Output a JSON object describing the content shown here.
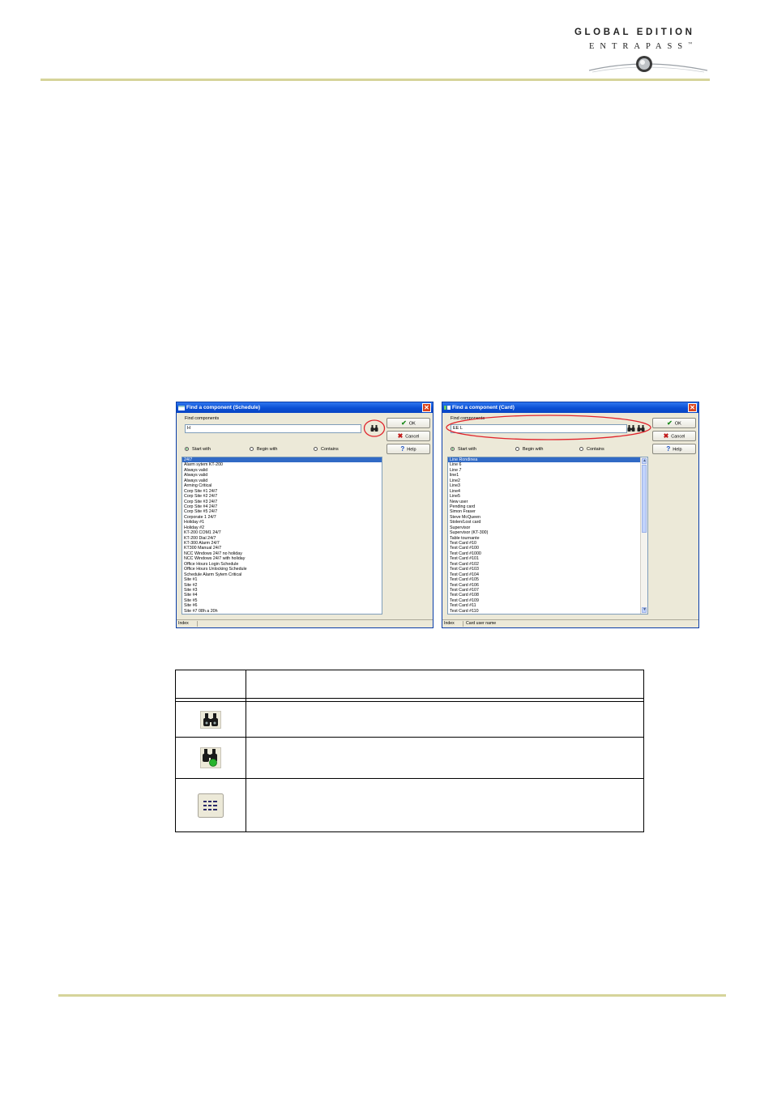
{
  "header": {
    "logo_line1": "GLOBAL EDITION",
    "logo_line2": "ENTRAPASS",
    "logo_mark": "™"
  },
  "dialog_schedule": {
    "title": "Find a component (Schedule)",
    "find_label": "Find components",
    "search_value": "H",
    "ok_label": "OK",
    "cancel_label": "Cancel",
    "help_label": "Help",
    "radio_options": [
      "Start with",
      "Begin with",
      "Contains"
    ],
    "selected_radio": 0,
    "items": [
      "24/7",
      "Alarm sytem KT-200",
      "Always valid",
      "Always valid",
      "Always valid",
      "Arming Critical",
      "Corp Site #1 24/7",
      "Corp Site #2 24/7",
      "Corp Site #3 24/7",
      "Corp Site #4 24/7",
      "Corp Site #5 24/7",
      "Corporate 1 24/7",
      "Holiday #1",
      "Holiday #2",
      "KT-200 COM1 24/7",
      "KT-200 Dial 24/7",
      "KT-300 Alarm 24/7",
      "KT300 Manual 24/7",
      "NCC Windows 24/7 no holiday",
      "NCC Windows 24/7 with holiday",
      "Office Hours Login Schedule",
      "Office Hours Unlocking Schedule",
      "Schedule Alarm Sytem Critical",
      "Site #1",
      "Site #2",
      "Site #3",
      "Site #4",
      "Site #5",
      "Site #6",
      "Site #7 08h a 20h"
    ],
    "status": [
      "Index"
    ]
  },
  "dialog_card": {
    "title": "Find a component (Card)",
    "find_label": "Find components",
    "search_value": "EE L",
    "ok_label": "OK",
    "cancel_label": "Cancel",
    "help_label": "Help",
    "radio_options": [
      "Start with",
      "Begin with",
      "Contains"
    ],
    "selected_radio": 0,
    "items": [
      "Line Rondinea",
      "Line 6",
      "Line 7",
      "line1",
      "Line2",
      "Line3",
      "Line4",
      "Line5",
      "New user",
      "Pending card",
      "Simon Fraser",
      "Steve McQueen",
      "Stolen/Lost card",
      "Supervisor",
      "Supervisor (KT-300)",
      "Table tournante",
      "Test Card #10",
      "Test Card #100",
      "Test Card #1000",
      "Test Card #101",
      "Test Card #102",
      "Test Card #103",
      "Test Card #104",
      "Test Card #105",
      "Test Card #106",
      "Test Card #107",
      "Test Card #108",
      "Test Card #109",
      "Test Card #11",
      "Test Card #110"
    ],
    "status": [
      "Index",
      "Card user name"
    ]
  },
  "table": {
    "icons": [
      "binoculars-icon",
      "binoculars-next-icon",
      "list-view-icon"
    ]
  },
  "colors": {
    "rule": "#d6d49a",
    "titlebar": "#0a4fd4",
    "selection": "#316ac5",
    "highlight_circle": "#e0242c"
  }
}
